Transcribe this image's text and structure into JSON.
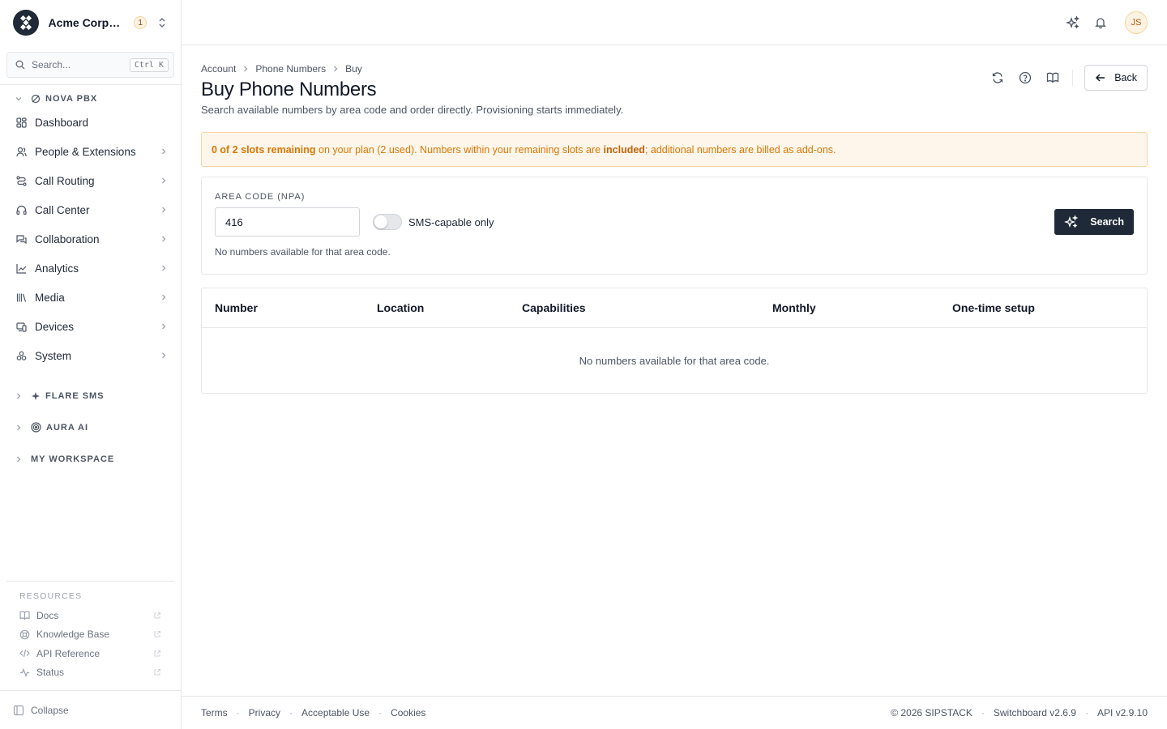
{
  "org": {
    "name": "Acme Corporation",
    "badge": "1"
  },
  "search": {
    "placeholder": "Search...",
    "shortcut": "Ctrl K"
  },
  "sidebar": {
    "section_main": {
      "title": "NOVA PBX",
      "icon": "pbx-icon"
    },
    "items": [
      {
        "label": "Dashboard",
        "icon": "dashboard-icon"
      },
      {
        "label": "People & Extensions",
        "icon": "people-icon"
      },
      {
        "label": "Call Routing",
        "icon": "routing-icon"
      },
      {
        "label": "Call Center",
        "icon": "headset-icon"
      },
      {
        "label": "Collaboration",
        "icon": "collaboration-icon"
      },
      {
        "label": "Analytics",
        "icon": "analytics-icon"
      },
      {
        "label": "Media",
        "icon": "media-icon"
      },
      {
        "label": "Devices",
        "icon": "devices-icon"
      },
      {
        "label": "System",
        "icon": "system-icon"
      }
    ],
    "sections_collapsed": [
      {
        "title": "FLARE SMS",
        "icon": "sparkle-icon"
      },
      {
        "title": "AURA AI",
        "icon": "aura-icon"
      },
      {
        "title": "MY WORKSPACE"
      }
    ],
    "resources": {
      "title": "RESOURCES",
      "items": [
        {
          "label": "Docs",
          "icon": "book-icon"
        },
        {
          "label": "Knowledge Base",
          "icon": "lifebuoy-icon"
        },
        {
          "label": "API Reference",
          "icon": "code-icon"
        },
        {
          "label": "Status",
          "icon": "activity-icon"
        }
      ]
    },
    "collapse_label": "Collapse"
  },
  "topbar": {
    "avatar_initials": "JS"
  },
  "page": {
    "breadcrumbs": [
      "Account",
      "Phone Numbers",
      "Buy"
    ],
    "title": "Buy Phone Numbers",
    "subtitle": "Search available numbers by area code and order directly. Provisioning starts immediately.",
    "back_label": "Back"
  },
  "alert": {
    "strong": "0 of 2 slots remaining",
    "text1": " on your plan (2 used). Numbers within your remaining slots are ",
    "strong2": "included",
    "text2": "; additional numbers are billed as add-ons."
  },
  "filter": {
    "label": "AREA CODE (NPA)",
    "value": "416",
    "sms_label": "SMS-capable only",
    "sms_checked": false,
    "search_label": "Search",
    "hint": "No numbers available for that area code."
  },
  "table": {
    "columns": [
      "Number",
      "Location",
      "Capabilities",
      "Monthly",
      "One-time setup"
    ],
    "empty": "No numbers available for that area code."
  },
  "footer": {
    "links": [
      "Terms",
      "Privacy",
      "Acceptable Use",
      "Cookies"
    ],
    "copyright": "© 2026 SIPSTACK",
    "version": "Switchboard v2.6.9",
    "api": "API v2.9.10"
  },
  "colors": {
    "accent": "#1f2937",
    "warning_bg": "#fef6ea",
    "warning_text": "#d97706",
    "border": "#e5e7eb"
  }
}
